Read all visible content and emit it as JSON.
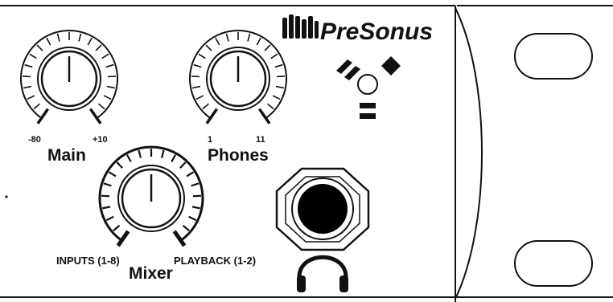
{
  "brand": {
    "name": "PreSonus"
  },
  "knobs": {
    "main": {
      "label": "Main",
      "min_label": "-80",
      "max_label": "+10"
    },
    "phones": {
      "label": "Phones",
      "min_label": "1",
      "max_label": "11"
    },
    "mixer": {
      "label": "Mixer",
      "left_label": "INPUTS (1-8)",
      "right_label": "PLAYBACK (1-2)"
    }
  },
  "indicators": {
    "led": "status-led",
    "symbols": [
      "mute-slashes-icon",
      "diamond-icon",
      "equals-icon"
    ]
  },
  "jacks": {
    "headphone": "headphone-icon"
  },
  "colors": {
    "ink": "#111111",
    "panel": "#ffffff",
    "jack": "#000000"
  }
}
